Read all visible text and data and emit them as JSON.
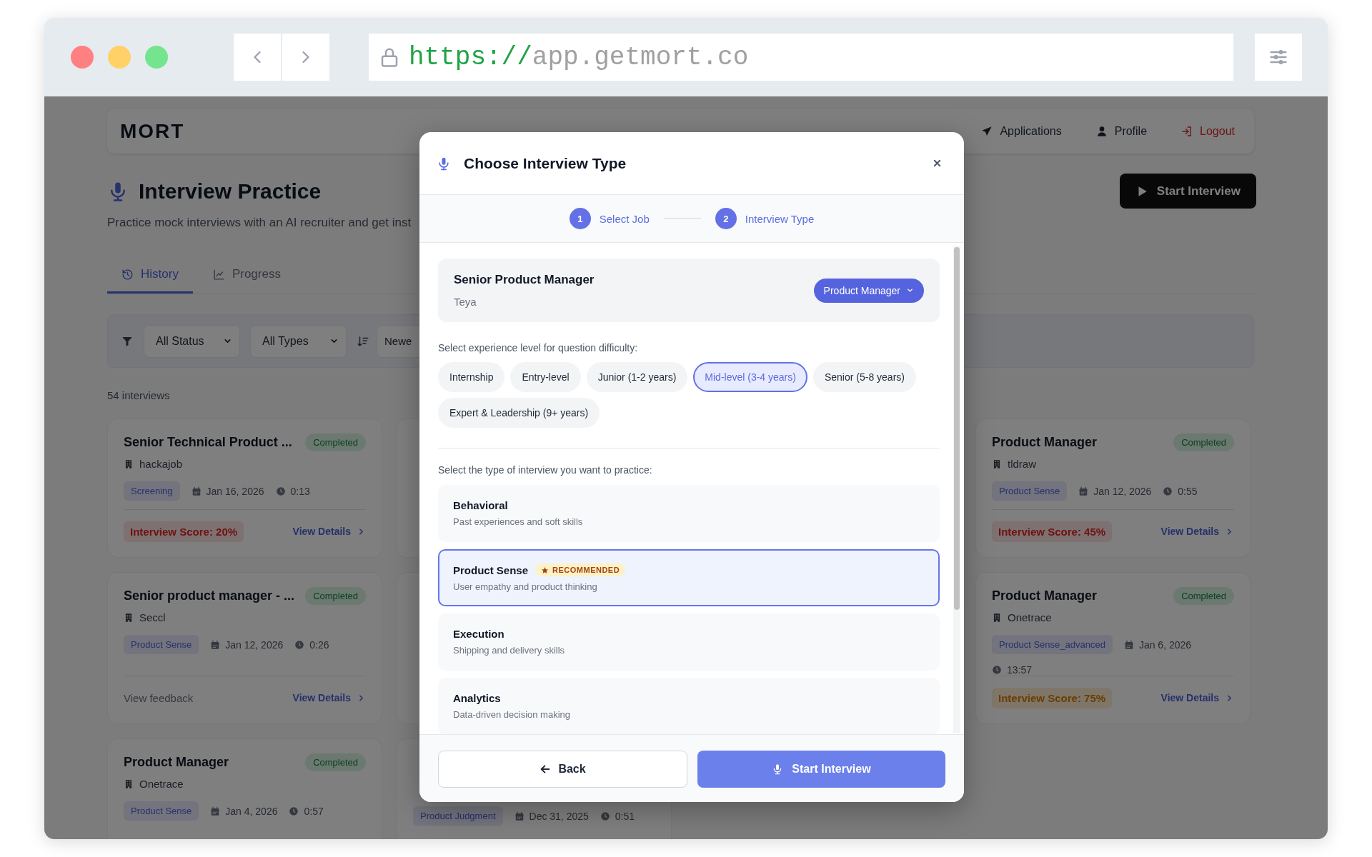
{
  "browser": {
    "url_scheme": "https://",
    "url_host": "app.getmort.co"
  },
  "navbar": {
    "logo": "MORT",
    "items": [
      {
        "label": "Applications",
        "kind": "applications"
      },
      {
        "label": "Profile",
        "kind": "profile"
      },
      {
        "label": "Logout",
        "kind": "logout"
      }
    ]
  },
  "header": {
    "title": "Interview Practice",
    "subtitle": "Practice mock interviews with an AI recruiter and get inst",
    "start_button": "Start Interview"
  },
  "tabs": [
    {
      "label": "History",
      "kind": "history",
      "selected": true
    },
    {
      "label": "Progress",
      "kind": "progress",
      "selected": false
    }
  ],
  "filters": {
    "status": "All Status",
    "type": "All Types",
    "sort": "Newe"
  },
  "count": "54 interviews",
  "columns": [
    {
      "cards": [
        {
          "kind": "full",
          "title": "Senior Technical Product ...",
          "status": "Completed",
          "company": "hackajob",
          "tag": "Screening",
          "date": "Jan 16, 2026",
          "duration": "0:13",
          "score": {
            "text": "Interview Score: 20%",
            "kind": "low"
          },
          "details_link": "View Details"
        },
        {
          "kind": "full",
          "title": "Senior product manager - ...",
          "status": "Completed",
          "company": "Seccl",
          "tag": "Product Sense",
          "date": "Jan 12, 2026",
          "duration": "0:26",
          "feedback_link": "View feedback",
          "details_link": "View Details"
        },
        {
          "kind": "full",
          "title": "Product Manager",
          "status": "Completed",
          "company": "Onetrace",
          "tag": "Product Sense",
          "date": "Jan 4, 2026",
          "duration": "0:57"
        }
      ]
    },
    {
      "cards": [
        {
          "kind": "covered"
        },
        {
          "kind": "covered"
        },
        {
          "kind": "covered",
          "tag": "Product Judgment",
          "date": "Dec 31, 2025",
          "duration": "0:51"
        }
      ]
    },
    {
      "cards": [
        {
          "kind": "full",
          "title": "Product Manager",
          "status": "Completed",
          "company": "tldraw",
          "tag": "Product Sense",
          "date": "Jan 12, 2026",
          "duration": "0:55",
          "score": {
            "text": "Interview Score: 45%",
            "kind": "low"
          },
          "details_link": "View Details"
        },
        {
          "kind": "full",
          "title": "Product Manager",
          "status": "Completed",
          "company": "Onetrace",
          "tag": "Product Sense_advanced",
          "date": "Jan 6, 2026",
          "duration": "13:57",
          "score": {
            "text": "Interview Score: 75%",
            "kind": "medium"
          },
          "details_link": "View Details"
        }
      ]
    }
  ],
  "modal": {
    "title": "Choose Interview Type",
    "steps": [
      {
        "number": "1",
        "label": "Select Job",
        "active": true
      },
      {
        "number": "2",
        "label": "Interview Type",
        "active": true
      }
    ],
    "job": {
      "title": "Senior Product Manager",
      "company": "Teya",
      "role": "Product Manager"
    },
    "level_prompt": "Select experience level for question difficulty:",
    "levels": [
      {
        "label": "Internship",
        "selected": false
      },
      {
        "label": "Entry-level",
        "selected": false
      },
      {
        "label": "Junior (1-2 years)",
        "selected": false
      },
      {
        "label": "Mid-level (3-4 years)",
        "selected": true
      },
      {
        "label": "Senior (5-8 years)",
        "selected": false
      },
      {
        "label": "Expert & Leadership (9+ years)",
        "selected": false
      }
    ],
    "type_prompt": "Select the type of interview you want to practice:",
    "types": [
      {
        "name": "Behavioral",
        "description": "Past experiences and soft skills",
        "selected": false
      },
      {
        "name": "Product Sense",
        "description": "User empathy and product thinking",
        "selected": true,
        "badge": "RECOMMENDED"
      },
      {
        "name": "Execution",
        "description": "Shipping and delivery skills",
        "selected": false
      },
      {
        "name": "Analytics",
        "description": "Data-driven decision making",
        "selected": false
      }
    ],
    "back_button": "Back",
    "start_button": "Start Interview"
  }
}
